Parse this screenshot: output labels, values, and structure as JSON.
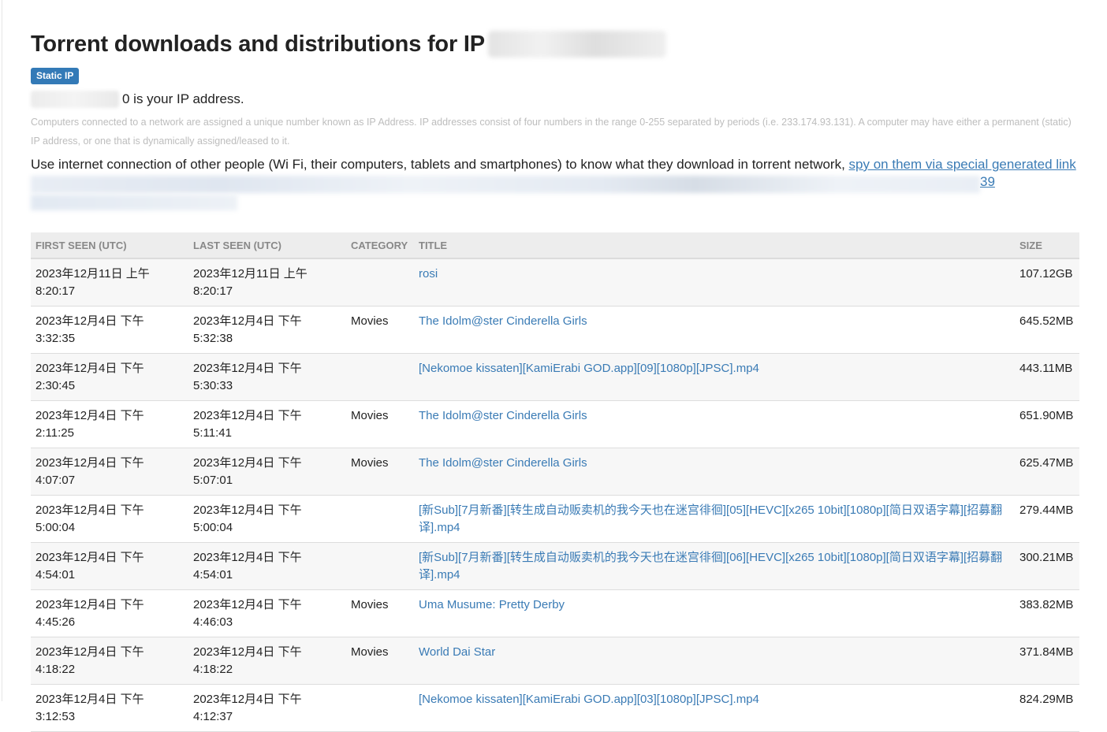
{
  "page": {
    "title": "Torrent downloads and distributions for IP",
    "badge": "Static IP",
    "ip_suffix": "0 is your IP address.",
    "explanation": "Computers connected to a network are assigned a unique number known as IP Address. IP addresses consist of four numbers in the range 0-255 separated by periods (i.e. 233.174.93.131). A computer may have either a permanent (static) IP address, or one that is dynamically assigned/leased to it.",
    "spy_text": "Use internet connection of other people (Wi Fi, their computers, tablets and smartphones) to know what they download in torrent network, ",
    "spy_link": "spy on them via special generated link",
    "link_tail": "39"
  },
  "table": {
    "headers": {
      "first_seen": "FIRST SEEN (UTC)",
      "last_seen": "LAST SEEN (UTC)",
      "category": "CATEGORY",
      "title": "TITLE",
      "size": "SIZE"
    },
    "rows": [
      {
        "first": "2023年12月11日 上午 8:20:17",
        "last": "2023年12月11日 上午 8:20:17",
        "category": "",
        "title": "rosi",
        "size": "107.12GB"
      },
      {
        "first": "2023年12月4日 下午 3:32:35",
        "last": "2023年12月4日 下午 5:32:38",
        "category": "Movies",
        "title": "The Idolm@ster Cinderella Girls",
        "size": "645.52MB"
      },
      {
        "first": "2023年12月4日 下午 2:30:45",
        "last": "2023年12月4日 下午 5:30:33",
        "category": "",
        "title": "[Nekomoe kissaten][KamiErabi GOD.app][09][1080p][JPSC].mp4",
        "size": "443.11MB"
      },
      {
        "first": "2023年12月4日 下午 2:11:25",
        "last": "2023年12月4日 下午 5:11:41",
        "category": "Movies",
        "title": "The Idolm@ster Cinderella Girls",
        "size": "651.90MB"
      },
      {
        "first": "2023年12月4日 下午 4:07:07",
        "last": "2023年12月4日 下午 5:07:01",
        "category": "Movies",
        "title": "The Idolm@ster Cinderella Girls",
        "size": "625.47MB"
      },
      {
        "first": "2023年12月4日 下午 5:00:04",
        "last": "2023年12月4日 下午 5:00:04",
        "category": "",
        "title": "[新Sub][7月新番][转生成自动贩卖机的我今天也在迷宫徘徊][05][HEVC][x265 10bit][1080p][简日双语字幕][招募翻译].mp4",
        "size": "279.44MB"
      },
      {
        "first": "2023年12月4日 下午 4:54:01",
        "last": "2023年12月4日 下午 4:54:01",
        "category": "",
        "title": "[新Sub][7月新番][转生成自动贩卖机的我今天也在迷宫徘徊][06][HEVC][x265 10bit][1080p][简日双语字幕][招募翻译].mp4",
        "size": "300.21MB"
      },
      {
        "first": "2023年12月4日 下午 4:45:26",
        "last": "2023年12月4日 下午 4:46:03",
        "category": "Movies",
        "title": "Uma Musume: Pretty Derby",
        "size": "383.82MB"
      },
      {
        "first": "2023年12月4日 下午 4:18:22",
        "last": "2023年12月4日 下午 4:18:22",
        "category": "Movies",
        "title": "World Dai Star",
        "size": "371.84MB"
      },
      {
        "first": "2023年12月4日 下午 3:12:53",
        "last": "2023年12月4日 下午 4:12:37",
        "category": "",
        "title": "[Nekomoe kissaten][KamiErabi GOD.app][03][1080p][JPSC].mp4",
        "size": "824.29MB"
      }
    ]
  }
}
